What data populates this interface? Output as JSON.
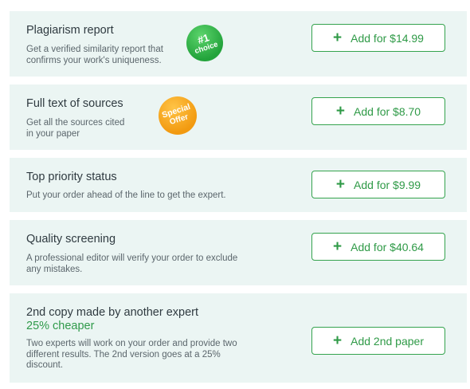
{
  "services": [
    {
      "title": "Plagiarism report",
      "desc_lines": [
        "Get a verified similarity report that",
        "confirms your work's uniqueness."
      ],
      "badge": {
        "line1": "#1",
        "line2": "choice",
        "color": "#2aa845"
      },
      "button": {
        "icon": "plus-icon",
        "label": "Add for $14.99"
      }
    },
    {
      "title": "Full text of sources",
      "desc_lines": [
        "Get all the sources cited",
        "in your paper"
      ],
      "badge": {
        "line1": "Special",
        "line2": "Offer",
        "color": "#f5a21b"
      },
      "button": {
        "icon": "plus-icon",
        "label": "Add for $8.70"
      }
    },
    {
      "title": "Top priority status",
      "desc_lines": [
        "Put your order ahead of the line to get the expert."
      ],
      "button": {
        "icon": "plus-icon",
        "label": "Add for $9.99"
      }
    },
    {
      "title": "Quality screening",
      "desc_lines": [
        "A professional editor will verify your order to exclude",
        "any mistakes."
      ],
      "button": {
        "icon": "plus-icon",
        "label": "Add for $40.64"
      }
    },
    {
      "title": "2nd copy made by another expert",
      "subtitle": "25% cheaper",
      "desc_lines": [
        "Two experts will work on your order and provide two",
        "different results. The 2nd version goes at a 25%",
        "discount."
      ],
      "button": {
        "icon": "plus-icon",
        "label": "Add 2nd paper"
      }
    }
  ],
  "colors": {
    "card_bg": "#ebf5f3",
    "accent_green": "#2f9a47",
    "badge_green": "#2aa845",
    "badge_orange": "#f5a21b"
  }
}
